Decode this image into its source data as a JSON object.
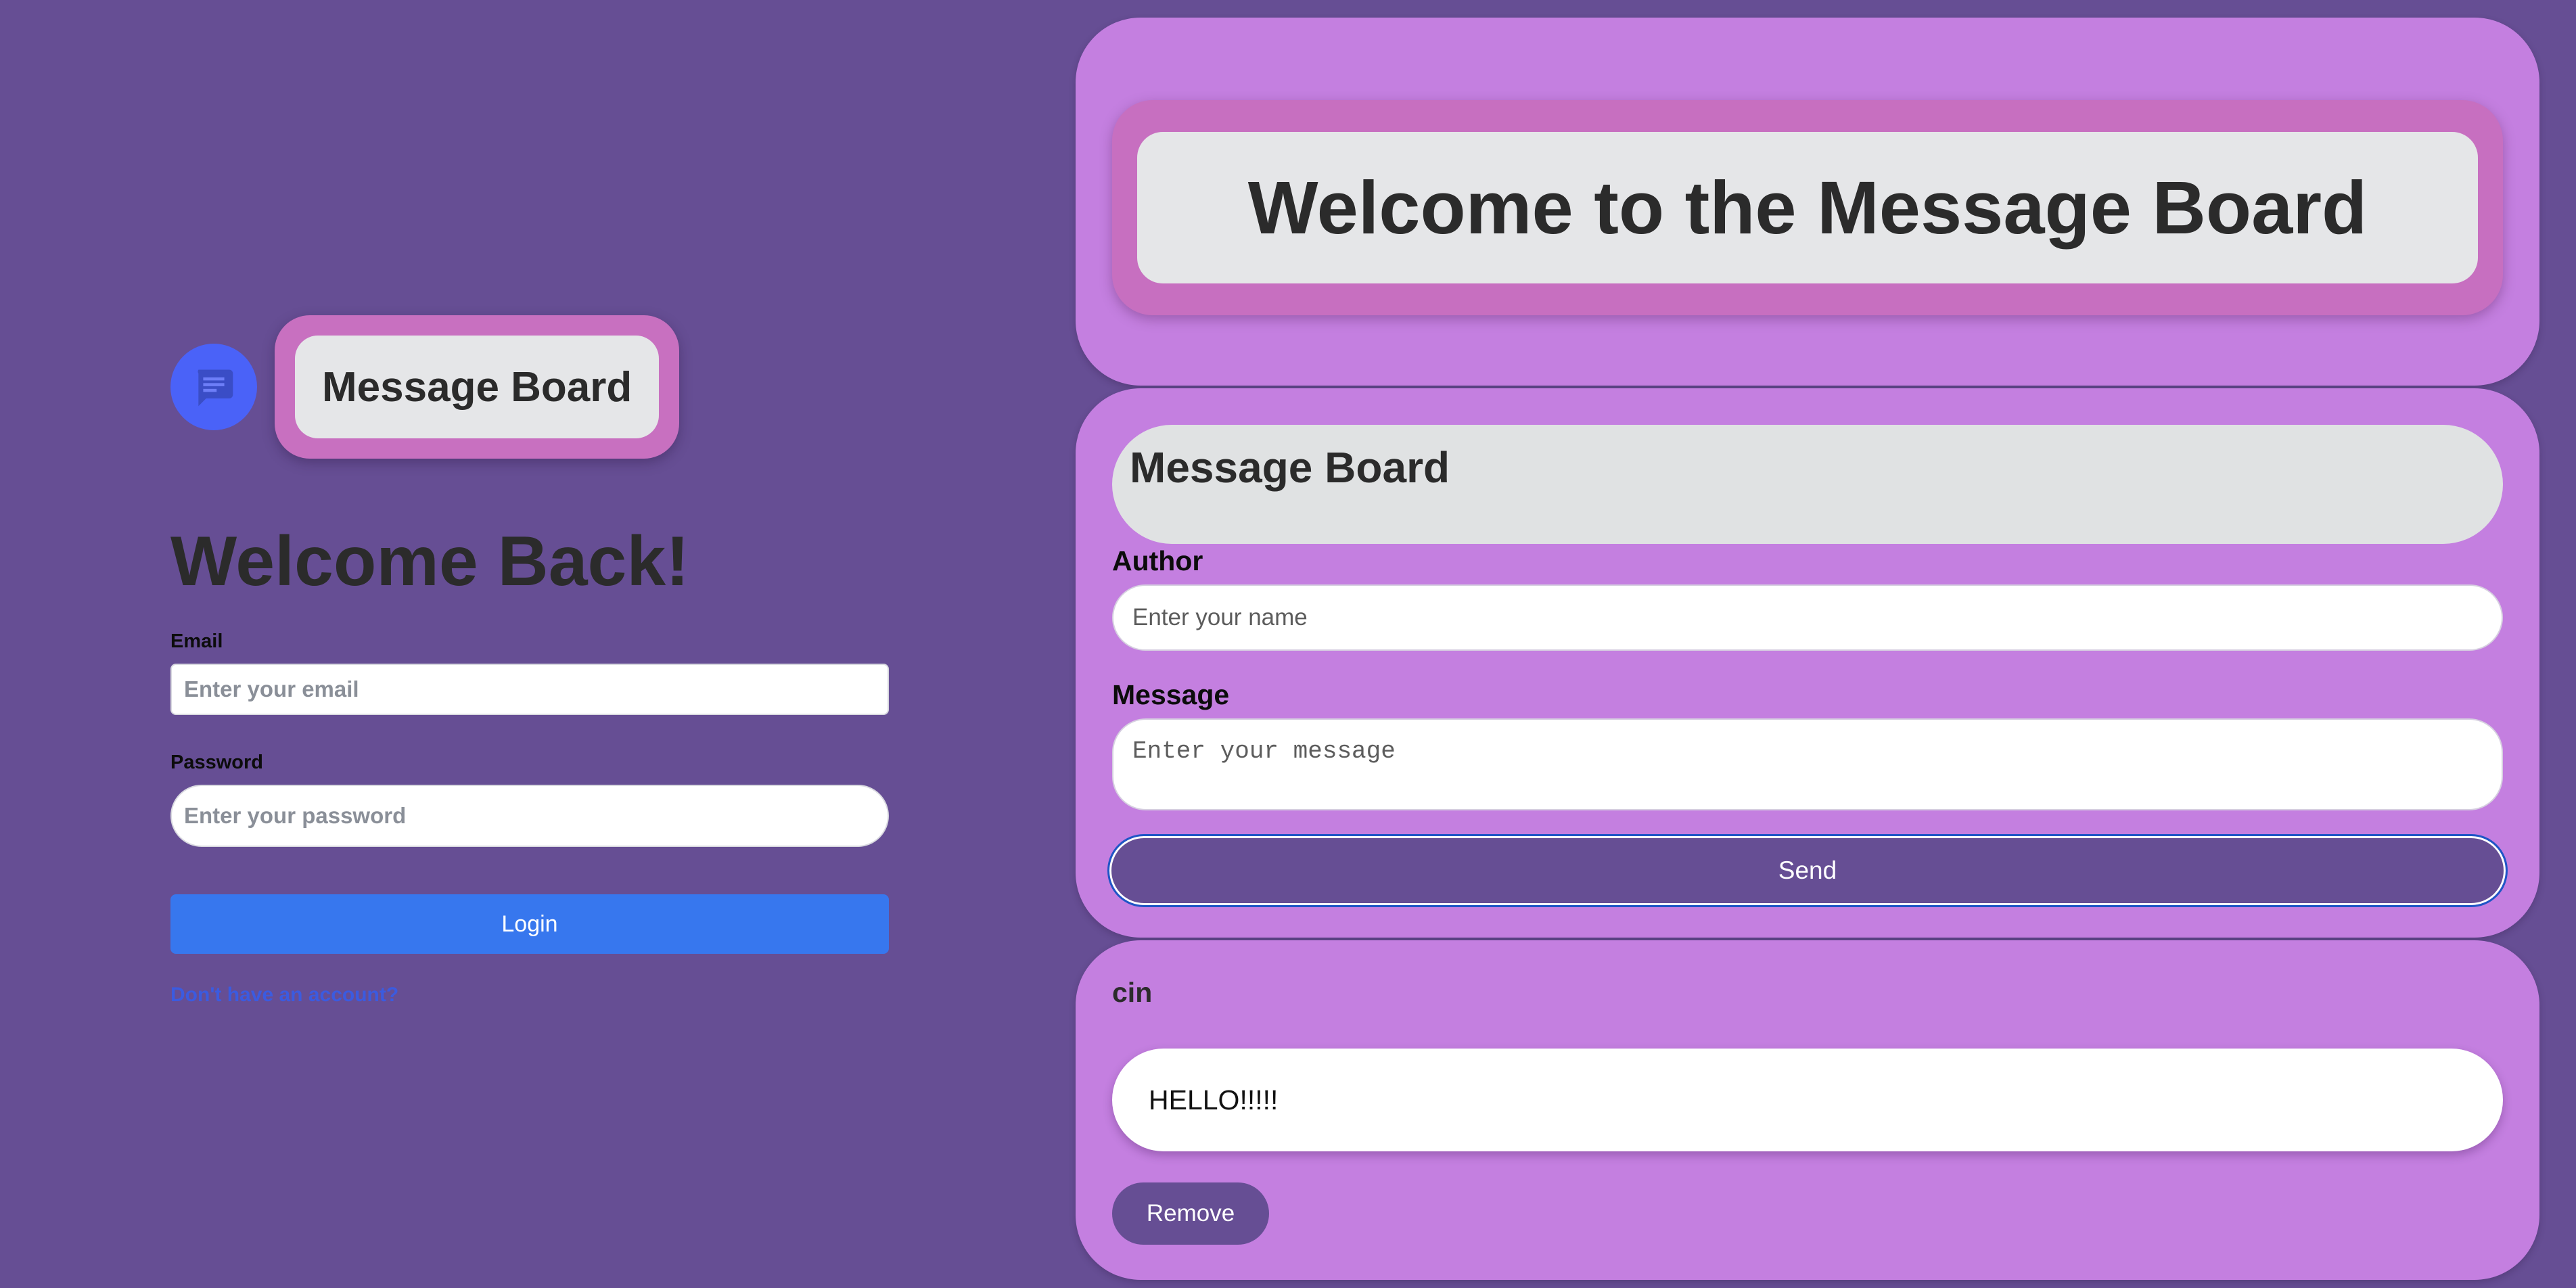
{
  "login": {
    "brand_title": "Message Board",
    "brand_icon": "chat-bubble-icon",
    "heading": "Welcome Back!",
    "email_label": "Email",
    "email_placeholder": "Enter your email",
    "password_label": "Password",
    "password_placeholder": "Enter your password",
    "login_label": "Login",
    "signup_link": "Don't have an account?"
  },
  "hero": {
    "title": "Welcome to the Message Board"
  },
  "form": {
    "heading": "Message Board",
    "author_label": "Author",
    "author_placeholder": "Enter your name",
    "message_label": "Message",
    "message_placeholder": "Enter your message",
    "send_label": "Send"
  },
  "posts": [
    {
      "author": "cin",
      "text": "HELLO!!!!!",
      "remove_label": "Remove"
    }
  ],
  "colors": {
    "background": "#664e94",
    "card": "#c47fe0",
    "accent_blue": "#3777ee",
    "logo_blue": "#4a62f8",
    "pink_frame": "#c870c0"
  }
}
